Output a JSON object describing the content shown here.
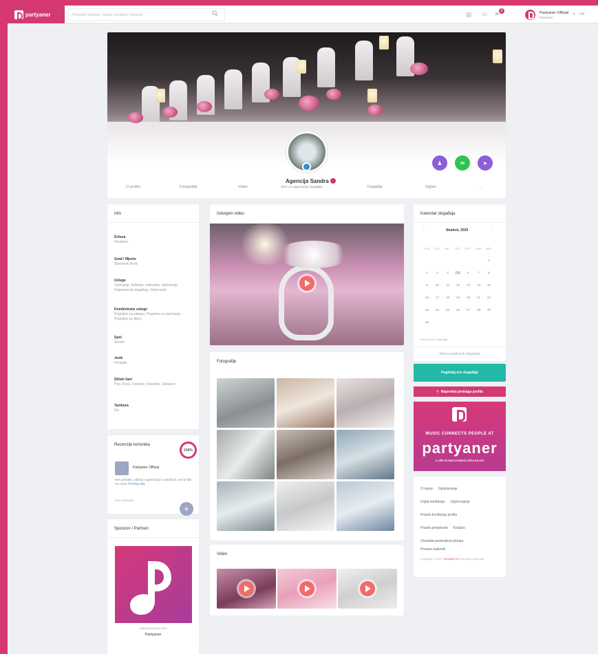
{
  "colors": {
    "brand": "#d43a72",
    "teal": "#24b8a7",
    "blue": "#2d8fd8",
    "page_bg": "#eef0f3"
  },
  "topbar": {
    "logo_text": "partyaner",
    "search_placeholder": "Pretražite sadržaje, mjesta, izvođače, tekstove...",
    "user_name": "Partyaner Official",
    "user_sub": "Partyaner",
    "lang": "HR"
  },
  "profile": {
    "name": "Agencija Sandra",
    "subtitle": "Služi za organizaciju događaja",
    "tabs": [
      "O profilu",
      "Fotografije",
      "Video",
      "Događaji",
      "Oglasi",
      "..."
    ],
    "fabs": [
      "follow-icon",
      "message-icon",
      "share-icon"
    ]
  },
  "info": {
    "title": "Info",
    "rows": [
      {
        "label": "Država",
        "value": "Hrvatska"
      },
      {
        "label": "Grad / Mjesto",
        "value": "Slavonski Brod"
      },
      {
        "label": "Usluge",
        "value": "Vjenčanje, krštenje, rođendan, dekoracija, Organizacija događaja, Dekoracije"
      },
      {
        "label": "Kombinirane usluge",
        "value": "Pogodno za zabavu, Pogodno za vjenčanje, Pogodno za djecu"
      },
      {
        "label": "Spol",
        "value": "Ženski"
      },
      {
        "label": "Jezik",
        "value": "Hrvatski"
      },
      {
        "label": "Stilski žanr",
        "value": "Pop, Rock, Domaće, Narodno, Zabavno"
      },
      {
        "label": "Tambura",
        "value": "Da"
      }
    ]
  },
  "reviews": {
    "title": "Recenzije korisnika",
    "rating": "100%",
    "author": "Partyaner Official",
    "text": "Sve pohvale, odlična organizacija i uslužnost, sve je bilo na razini.",
    "more": "Pročitaj više",
    "all": "Sve recenzije"
  },
  "sponsor": {
    "title": "Sponzori / Partneri",
    "url": "www.partyaner.com",
    "name": "Partyaner"
  },
  "featured": {
    "title": "Izdvojeni video"
  },
  "photos": {
    "title": "Fotografije"
  },
  "videos": {
    "title": "Video"
  },
  "events": {
    "title": "Kalendar događaja",
    "month": "Studeni, 2020",
    "dow": [
      "PON",
      "UTO",
      "SRI",
      "ČET",
      "PET",
      "SUB",
      "NED"
    ],
    "days": [
      "1",
      "2",
      "3",
      "4",
      "5",
      "6",
      "7",
      "8",
      "9",
      "10",
      "11",
      "12",
      "13",
      "14",
      "15",
      "16",
      "17",
      "18",
      "19",
      "20",
      "21",
      "22",
      "23",
      "24",
      "25",
      "26",
      "27",
      "28",
      "29",
      "30"
    ],
    "today": "5",
    "legend": "Nema novih događaja",
    "no_events": "Nema odabranih događaja"
  },
  "buttons": {
    "all_events": "Pogledaj sve događaje",
    "advanced_search": "Napredna pretraga profila"
  },
  "promo": {
    "tag": "MUSIC CONNECTS PEOPLE AT",
    "brand": "partyaner",
    "bottom": "A VIŠE OD 5000 IZVOĐAČA ČEKA NA VAS"
  },
  "footer": {
    "links": [
      [
        "O nama",
        "Oglašavanje"
      ],
      [
        "Uvjeti korištenja",
        "Uvjeti kupnje"
      ],
      [
        "Pravila korištenja profila"
      ],
      [
        "Pravila privatnosti",
        "Kolačići"
      ],
      [
        "Učestala postavljena pitanja"
      ],
      [
        "Postani sudionik"
      ]
    ],
    "copyright": "Copyright © 2020.",
    "copyright_brand": "Partyaner.hr",
    "copyright_tail": "Sva prava pridržana."
  }
}
